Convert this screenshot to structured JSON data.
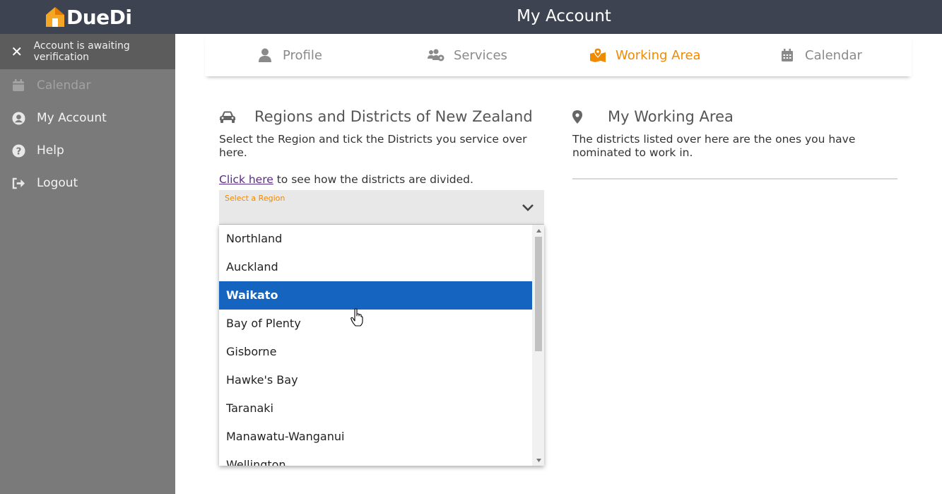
{
  "app": {
    "logo_text": "DueDi",
    "page_title": "My Account"
  },
  "sidebar": {
    "notice": "Account is awaiting verification",
    "items": [
      {
        "label": "Calendar",
        "icon": "calendar-icon",
        "disabled": true
      },
      {
        "label": "My Account",
        "icon": "user-circle-icon"
      },
      {
        "label": "Help",
        "icon": "question-circle-icon"
      },
      {
        "label": "Logout",
        "icon": "sign-out-icon"
      }
    ]
  },
  "tabs": [
    {
      "label": "Profile",
      "icon": "user-icon"
    },
    {
      "label": "Services",
      "icon": "users-cog-icon"
    },
    {
      "label": "Working Area",
      "icon": "map-marked-icon",
      "active": true
    },
    {
      "label": "Calendar",
      "icon": "calendar-icon"
    }
  ],
  "regions_section": {
    "title": "Regions and Districts of New Zealand",
    "description": "Select the Region and tick the Districts you service over here.",
    "link_text": "Click here",
    "link_suffix": " to see how the districts are divided.",
    "select_label": "Select a Region",
    "options": [
      "Northland",
      "Auckland",
      "Waikato",
      "Bay of Plenty",
      "Gisborne",
      "Hawke's Bay",
      "Taranaki",
      "Manawatu-Wanganui",
      "Wellington"
    ],
    "highlighted_option": "Waikato"
  },
  "working_area_section": {
    "title": "My Working Area",
    "description": "The districts listed over here are the ones you have nominated to work in."
  },
  "colors": {
    "accent": "#f08a00",
    "topbar": "#3d4350",
    "sidebar": "#7a7a7a",
    "selection": "#1565c0"
  }
}
